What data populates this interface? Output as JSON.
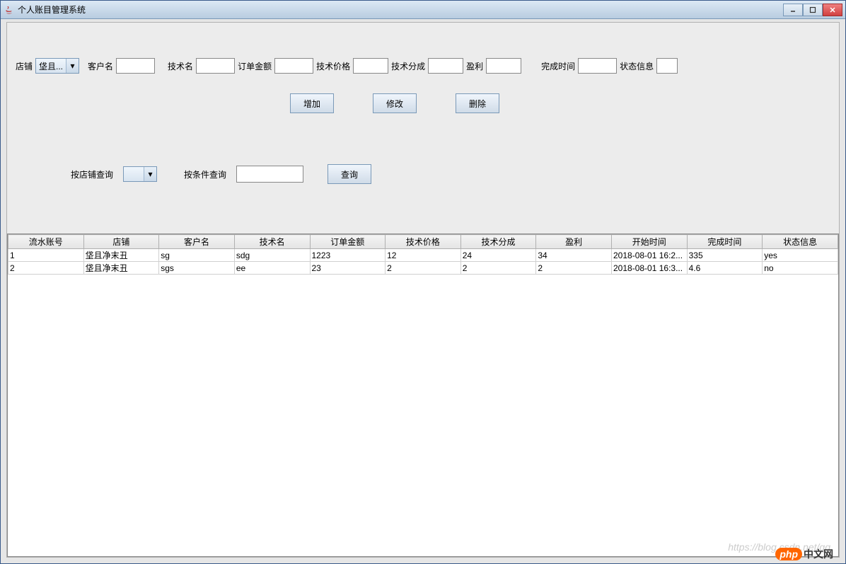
{
  "window": {
    "title": "个人账目管理系统"
  },
  "form": {
    "shop_label": "店铺",
    "shop_value": "垡且...",
    "customer_label": "客户名",
    "tech_label": "技术名",
    "order_amount_label": "订单金额",
    "tech_price_label": "技术价格",
    "tech_share_label": "技术分成",
    "profit_label": "盈利",
    "finish_time_label": "完成时间",
    "status_label": "状态信息"
  },
  "buttons": {
    "add": "增加",
    "edit": "修改",
    "delete": "删除"
  },
  "search": {
    "by_shop_label": "按店铺查询",
    "by_cond_label": "按条件查询",
    "query_btn": "查询"
  },
  "table": {
    "headers": [
      "流水账号",
      "店铺",
      "客户名",
      "技术名",
      "订单金额",
      "技术价格",
      "技术分成",
      "盈利",
      "开始时间",
      "完成时间",
      "状态信息"
    ],
    "rows": [
      [
        "1",
        "垡且净末丑",
        "sg",
        "sdg",
        "1223",
        "12",
        "24",
        "34",
        "2018-08-01 16:2...",
        "335",
        "yes"
      ],
      [
        "2",
        "垡且净末丑",
        "sgs",
        "ee",
        "23",
        "2",
        "2",
        "2",
        "2018-08-01 16:3...",
        "4.6",
        "no"
      ]
    ]
  },
  "watermark": "https://blog.csdn.net/qq",
  "logo": {
    "php": "php",
    "cn": "中文网"
  }
}
